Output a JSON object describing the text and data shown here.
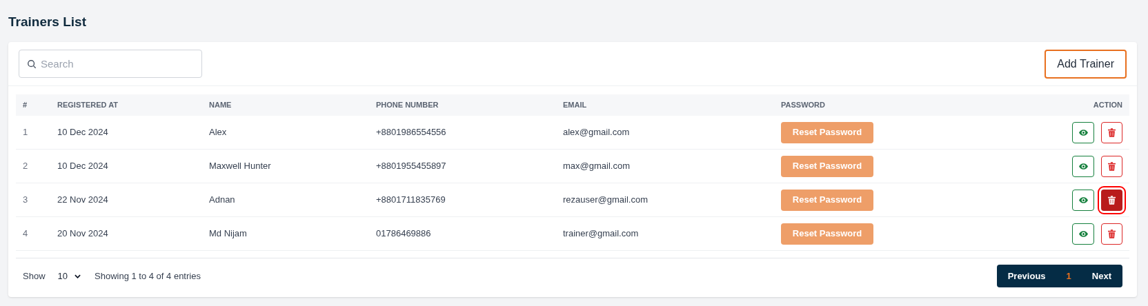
{
  "title": "Trainers List",
  "search": {
    "placeholder": "Search"
  },
  "add_button": "Add Trainer",
  "table": {
    "columns": [
      "#",
      "REGISTERED AT",
      "NAME",
      "PHONE NUMBER",
      "EMAIL",
      "PASSWORD",
      "ACTION"
    ],
    "rows": [
      {
        "index": "1",
        "registered_at": "10 Dec 2024",
        "name": "Alex",
        "phone": "+8801986554556",
        "email": "alex@gmail.com",
        "reset_label": "Reset Password",
        "delete_highlighted": false
      },
      {
        "index": "2",
        "registered_at": "10 Dec 2024",
        "name": "Maxwell Hunter",
        "phone": "+8801955455897",
        "email": "max@gmail.com",
        "reset_label": "Reset Password",
        "delete_highlighted": false
      },
      {
        "index": "3",
        "registered_at": "22 Nov 2024",
        "name": "Adnan",
        "phone": "+8801711835769",
        "email": "rezauser@gmail.com",
        "reset_label": "Reset Password",
        "delete_highlighted": true
      },
      {
        "index": "4",
        "registered_at": "20 Nov 2024",
        "name": "Md Nijam",
        "phone": "01786469886",
        "email": "trainer@gmail.com",
        "reset_label": "Reset Password",
        "delete_highlighted": false
      }
    ]
  },
  "footer": {
    "show_label": "Show",
    "page_size": "10",
    "summary": "Showing 1 to 4 of 4 entries"
  },
  "pagination": {
    "previous": "Previous",
    "pages": [
      {
        "label": "1",
        "selected": true
      }
    ],
    "next": "Next"
  }
}
